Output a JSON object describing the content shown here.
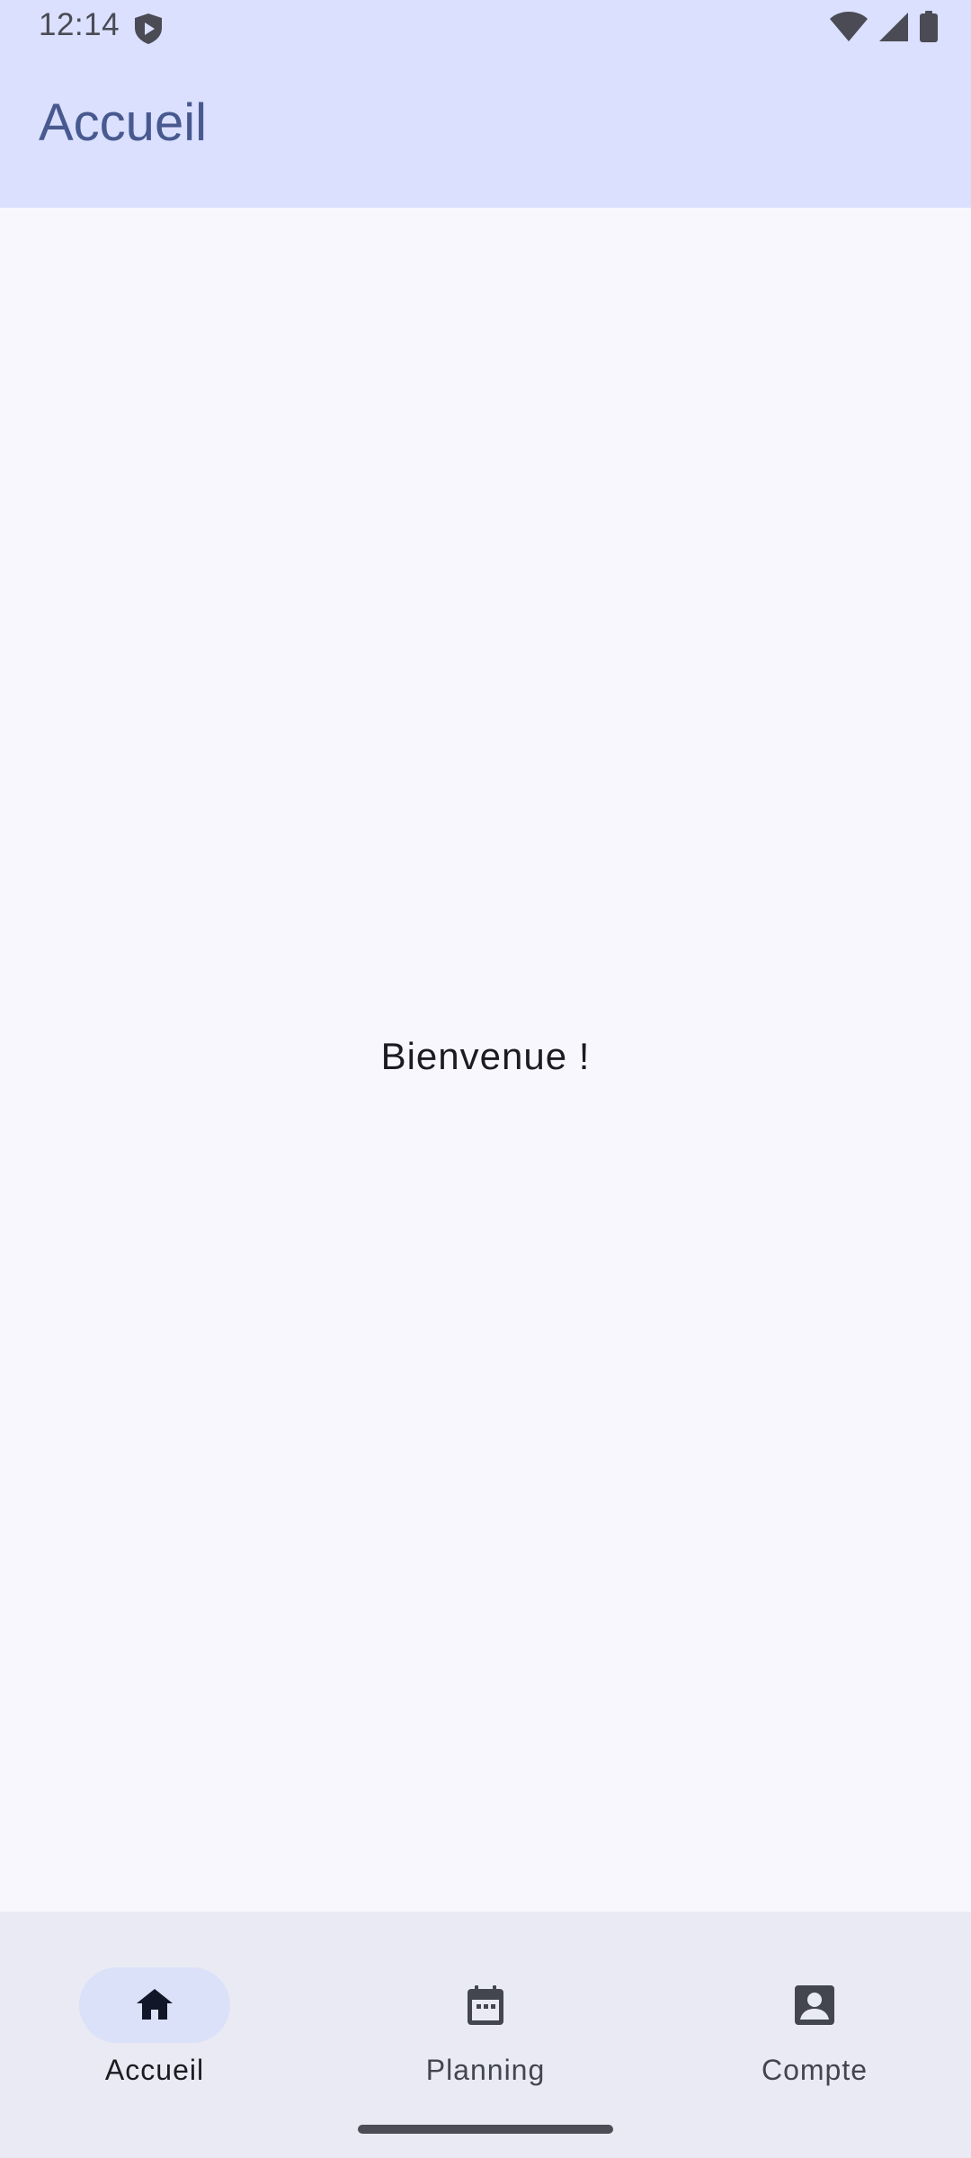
{
  "status_bar": {
    "time": "12:14",
    "icons": [
      "shield-play-icon",
      "wifi-icon",
      "signal-icon",
      "battery-icon"
    ]
  },
  "app_bar": {
    "title": "Accueil"
  },
  "main": {
    "welcome_text": "Bienvenue !"
  },
  "bottom_nav": {
    "items": [
      {
        "label": "Accueil",
        "icon": "home-icon",
        "active": true
      },
      {
        "label": "Planning",
        "icon": "calendar-icon",
        "active": false
      },
      {
        "label": "Compte",
        "icon": "account-box-icon",
        "active": false
      }
    ]
  },
  "colors": {
    "app_bar_bg": "#dae0fd",
    "title": "#48598f",
    "background": "#f8f7fd",
    "nav_bg": "#eaeaf4",
    "active_pill": "#dbe1f8"
  }
}
